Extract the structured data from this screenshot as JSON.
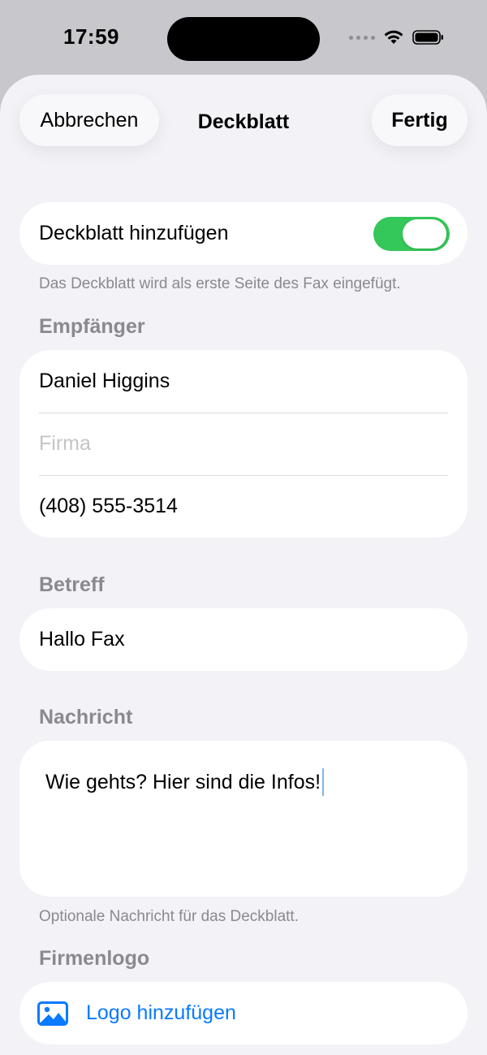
{
  "status_bar": {
    "time": "17:59"
  },
  "nav": {
    "cancel_label": "Abbrechen",
    "title": "Deckblatt",
    "done_label": "Fertig"
  },
  "cover_toggle": {
    "label": "Deckblatt hinzufügen",
    "enabled": true,
    "footnote": "Das Deckblatt wird als erste Seite des Fax eingefügt."
  },
  "recipient": {
    "header": "Empfänger",
    "name": "Daniel Higgins",
    "company_placeholder": "Firma",
    "phone": "(408) 555-3514"
  },
  "subject": {
    "header": "Betreff",
    "value": "Hallo Fax"
  },
  "message": {
    "header": "Nachricht",
    "value": "Wie gehts? Hier sind die Infos!",
    "footnote": "Optionale Nachricht für das Deckblatt."
  },
  "logo": {
    "header": "Firmenlogo",
    "add_label": "Logo hinzufügen"
  },
  "icons": {
    "wifi": "wifi-icon",
    "battery": "battery-icon",
    "cellular": "cellular-icon",
    "photo": "photo-icon"
  },
  "colors": {
    "accent": "#0a7aff",
    "toggle_on": "#34c759",
    "sheet_background": "#f2f2f7",
    "secondary_text": "#8a8a8e"
  }
}
